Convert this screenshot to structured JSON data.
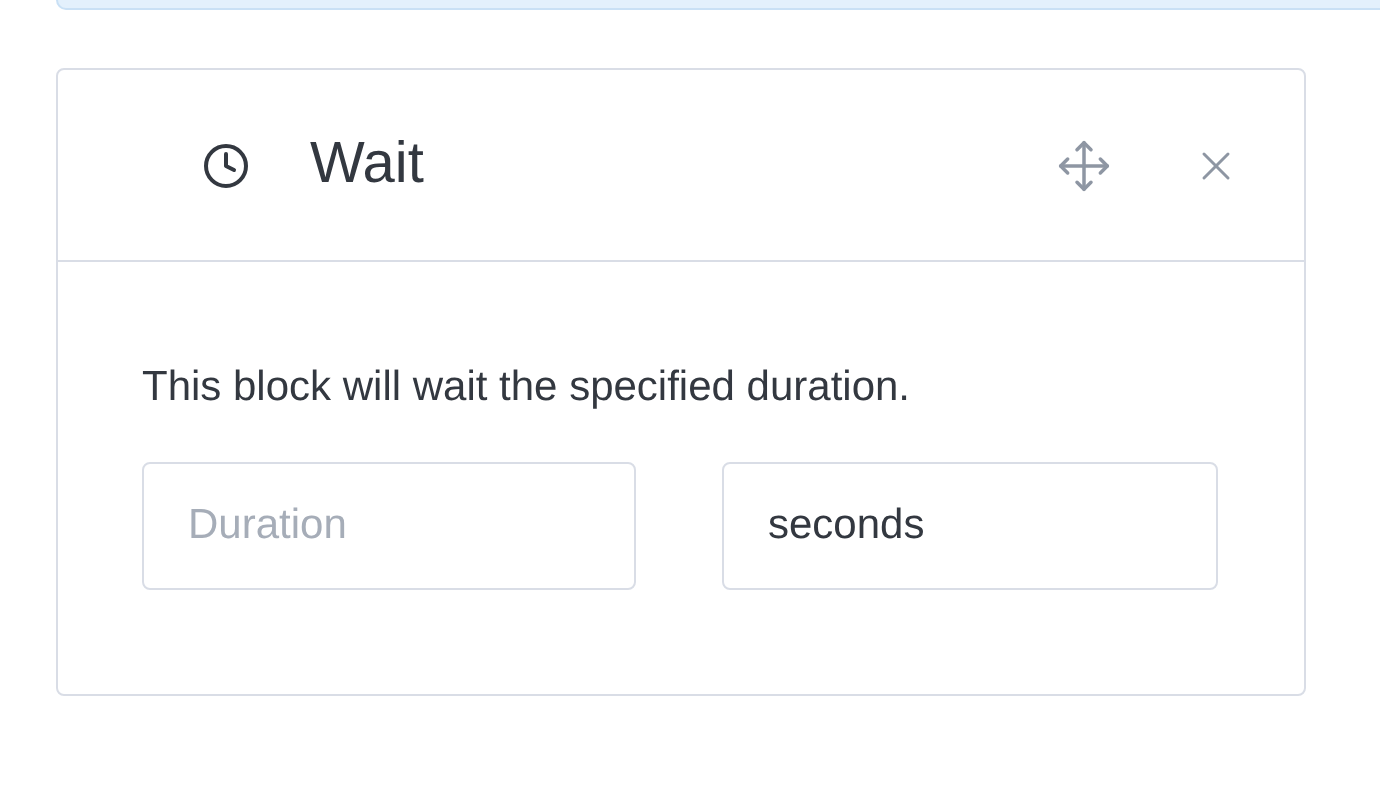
{
  "block": {
    "title": "Wait",
    "description": "This block will wait the specified duration.",
    "duration": {
      "placeholder": "Duration"
    },
    "unit": {
      "value": "seconds"
    }
  }
}
